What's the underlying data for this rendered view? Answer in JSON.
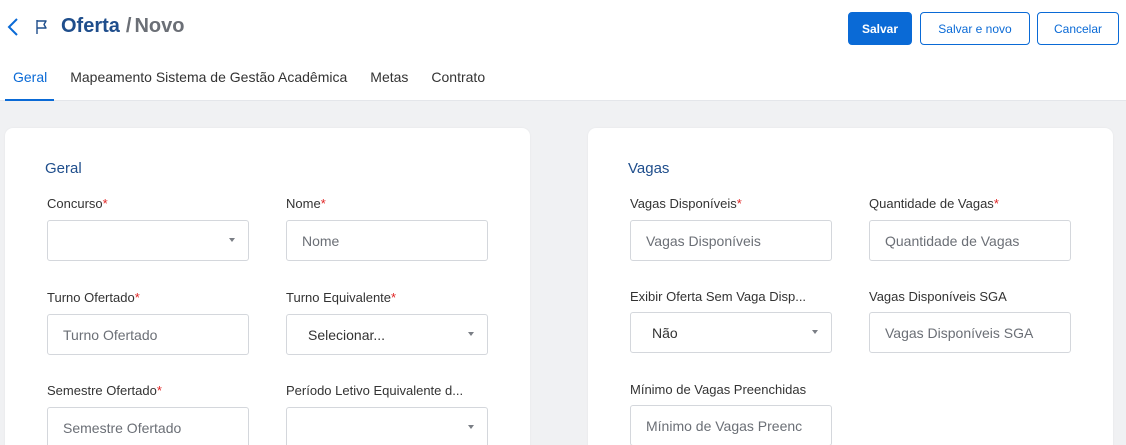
{
  "header": {
    "title_main": "Oferta",
    "title_sep": "/",
    "title_sub": "Novo",
    "save_label": "Salvar",
    "save_new_label": "Salvar e novo",
    "cancel_label": "Cancelar"
  },
  "tabs": [
    {
      "label": "Geral",
      "active": true
    },
    {
      "label": "Mapeamento Sistema de Gestão Acadêmica",
      "active": false
    },
    {
      "label": "Metas",
      "active": false
    },
    {
      "label": "Contrato",
      "active": false
    }
  ],
  "geral": {
    "title": "Geral",
    "concurso": {
      "label": "Concurso",
      "required": "*",
      "value": ""
    },
    "nome": {
      "label": "Nome",
      "required": "*",
      "placeholder": "Nome"
    },
    "turno_ofertado": {
      "label": "Turno Ofertado",
      "required": "*",
      "placeholder": "Turno Ofertado"
    },
    "turno_equivalente": {
      "label": "Turno Equivalente",
      "required": "*",
      "value": "Selecionar..."
    },
    "semestre_ofertado": {
      "label": "Semestre Ofertado",
      "required": "*",
      "placeholder": "Semestre Ofertado"
    },
    "periodo_letivo": {
      "label": "Período Letivo Equivalente d...",
      "value": ""
    }
  },
  "vagas": {
    "title": "Vagas",
    "vagas_disponiveis": {
      "label": "Vagas Disponíveis",
      "required": "*",
      "placeholder": "Vagas Disponíveis"
    },
    "quantidade_vagas": {
      "label": "Quantidade de Vagas",
      "required": "*",
      "placeholder": "Quantidade de Vagas"
    },
    "exibir_oferta": {
      "label": "Exibir Oferta Sem Vaga Disp...",
      "value": "Não"
    },
    "vagas_sga": {
      "label": "Vagas Disponíveis SGA",
      "placeholder": "Vagas Disponíveis SGA"
    },
    "minimo_vagas": {
      "label": "Mínimo de Vagas Preenchidas",
      "placeholder": "Mínimo de Vagas Preenc"
    }
  },
  "colors": {
    "primary": "#0a6ad6",
    "title": "#1f4e8c",
    "required": "#e02424",
    "background": "#f0f1f3"
  }
}
